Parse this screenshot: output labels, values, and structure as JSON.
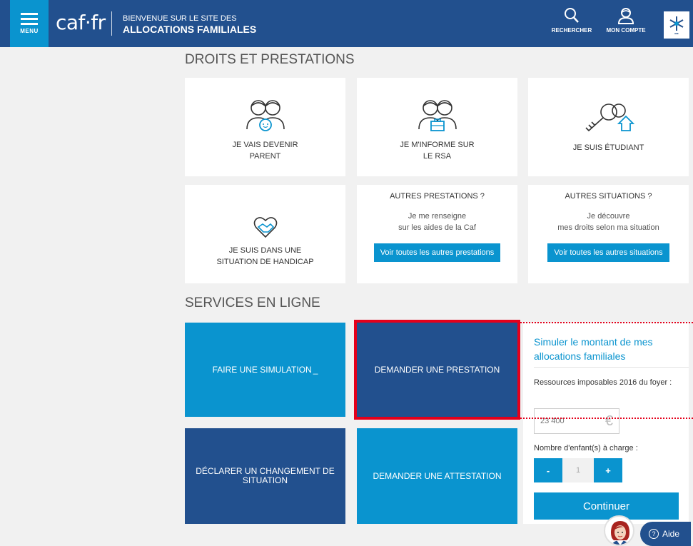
{
  "header": {
    "menu_label": "MENU",
    "logo_text": "caf·fr",
    "welcome_line1": "BIENVENUE SUR LE SITE DES",
    "welcome_line2": "ALLOCATIONS FAMILIALES",
    "search_label": "RECHERCHER",
    "account_label": "MON COMPTE",
    "brand_color": "#22508e",
    "accent_color": "#0a94cf"
  },
  "droits": {
    "title": "DROITS ET PRESTATIONS",
    "tiles": [
      {
        "line1": "JE VAIS DEVENIR",
        "line2": "PARENT",
        "icon": "parents-baby-icon"
      },
      {
        "line1": "JE M'INFORME SUR",
        "line2": "LE RSA",
        "icon": "people-briefcase-icon"
      },
      {
        "line1": "JE SUIS ÉTUDIANT",
        "line2": "",
        "icon": "keys-house-icon"
      },
      {
        "line1": "JE SUIS DANS UNE",
        "line2": "SITUATION DE HANDICAP",
        "icon": "heart-handshake-icon"
      }
    ],
    "autres_prestations": {
      "heading": "AUTRES PRESTATIONS ?",
      "line1": "Je me renseigne",
      "line2": "sur les aides de la Caf",
      "button": "Voir toutes les autres prestations"
    },
    "autres_situations": {
      "heading": "AUTRES SITUATIONS ?",
      "line1": "Je découvre",
      "line2": "mes droits selon ma situation",
      "button": "Voir toutes les autres situations"
    }
  },
  "services": {
    "title": "SERVICES EN LIGNE",
    "simulation": "FAIRE UNE SIMULATION",
    "simulation_cursor": "_",
    "demander_prestation": "DEMANDER UNE PRESTATION",
    "declarer_line1": "DÉCLARER UN CHANGEMENT DE",
    "declarer_line2": "SITUATION",
    "demander_attestation": "DEMANDER UNE ATTESTATION"
  },
  "simulator": {
    "title": "Simuler le montant de mes allocations familiales",
    "ressources_label": "Ressources imposables 2016 du foyer :",
    "ressources_placeholder": "23 400",
    "currency": "€",
    "children_label": "Nombre d'enfant(s) à charge :",
    "minus": "-",
    "children_value": "1",
    "plus": "+",
    "submit": "Continuer"
  },
  "aide": {
    "icon_char": "?",
    "label": "Aide"
  }
}
